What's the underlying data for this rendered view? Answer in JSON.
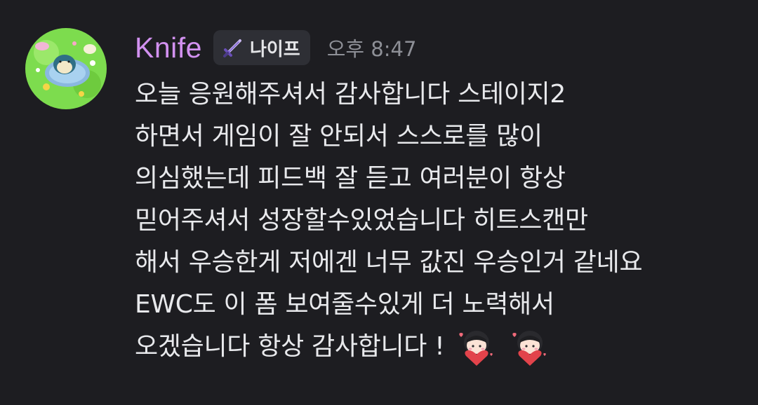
{
  "message": {
    "author": {
      "name": "Knife",
      "name_color": "#d291f0",
      "tag_label": "나이프",
      "tag_icon": "sword-icon"
    },
    "timestamp": "오후 8:47",
    "lines": [
      "오늘 응원해주셔서 감사합니다 스테이지2",
      "하면서 게임이 잘 안되서 스스로를 많이",
      "의심했는데 피드백 잘 듣고 여러분이 항상",
      "믿어주셔서 성장할수있었습니다 히트스캔만",
      "해서 우승한게 저에겐 너무 값진 우승인거 같네요",
      "EWC도 이 폼 보여줄수있게 더 노력해서",
      "오겠습니다 항상 감사합니다 !"
    ],
    "emojis": [
      "heart-chibi-emoji",
      "heart-chibi-emoji"
    ]
  },
  "colors": {
    "background": "#1d1d21",
    "text": "#e8e9ec",
    "timestamp": "#8e9097",
    "tag_background": "#2e2f35"
  }
}
